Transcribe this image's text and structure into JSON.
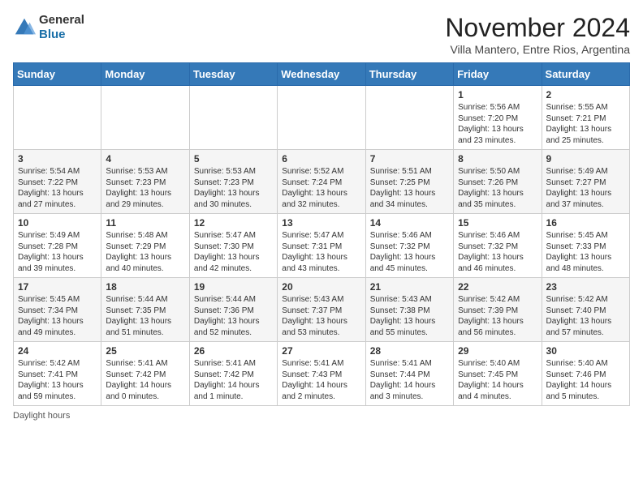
{
  "header": {
    "logo_line1": "General",
    "logo_line2": "Blue",
    "title": "November 2024",
    "subtitle": "Villa Mantero, Entre Rios, Argentina"
  },
  "days_of_week": [
    "Sunday",
    "Monday",
    "Tuesday",
    "Wednesday",
    "Thursday",
    "Friday",
    "Saturday"
  ],
  "footer": {
    "note": "Daylight hours"
  },
  "weeks": [
    [
      {
        "date": "",
        "info": ""
      },
      {
        "date": "",
        "info": ""
      },
      {
        "date": "",
        "info": ""
      },
      {
        "date": "",
        "info": ""
      },
      {
        "date": "",
        "info": ""
      },
      {
        "date": "1",
        "info": "Sunrise: 5:56 AM\nSunset: 7:20 PM\nDaylight: 13 hours and 23 minutes."
      },
      {
        "date": "2",
        "info": "Sunrise: 5:55 AM\nSunset: 7:21 PM\nDaylight: 13 hours and 25 minutes."
      }
    ],
    [
      {
        "date": "3",
        "info": "Sunrise: 5:54 AM\nSunset: 7:22 PM\nDaylight: 13 hours and 27 minutes."
      },
      {
        "date": "4",
        "info": "Sunrise: 5:53 AM\nSunset: 7:23 PM\nDaylight: 13 hours and 29 minutes."
      },
      {
        "date": "5",
        "info": "Sunrise: 5:53 AM\nSunset: 7:23 PM\nDaylight: 13 hours and 30 minutes."
      },
      {
        "date": "6",
        "info": "Sunrise: 5:52 AM\nSunset: 7:24 PM\nDaylight: 13 hours and 32 minutes."
      },
      {
        "date": "7",
        "info": "Sunrise: 5:51 AM\nSunset: 7:25 PM\nDaylight: 13 hours and 34 minutes."
      },
      {
        "date": "8",
        "info": "Sunrise: 5:50 AM\nSunset: 7:26 PM\nDaylight: 13 hours and 35 minutes."
      },
      {
        "date": "9",
        "info": "Sunrise: 5:49 AM\nSunset: 7:27 PM\nDaylight: 13 hours and 37 minutes."
      }
    ],
    [
      {
        "date": "10",
        "info": "Sunrise: 5:49 AM\nSunset: 7:28 PM\nDaylight: 13 hours and 39 minutes."
      },
      {
        "date": "11",
        "info": "Sunrise: 5:48 AM\nSunset: 7:29 PM\nDaylight: 13 hours and 40 minutes."
      },
      {
        "date": "12",
        "info": "Sunrise: 5:47 AM\nSunset: 7:30 PM\nDaylight: 13 hours and 42 minutes."
      },
      {
        "date": "13",
        "info": "Sunrise: 5:47 AM\nSunset: 7:31 PM\nDaylight: 13 hours and 43 minutes."
      },
      {
        "date": "14",
        "info": "Sunrise: 5:46 AM\nSunset: 7:32 PM\nDaylight: 13 hours and 45 minutes."
      },
      {
        "date": "15",
        "info": "Sunrise: 5:46 AM\nSunset: 7:32 PM\nDaylight: 13 hours and 46 minutes."
      },
      {
        "date": "16",
        "info": "Sunrise: 5:45 AM\nSunset: 7:33 PM\nDaylight: 13 hours and 48 minutes."
      }
    ],
    [
      {
        "date": "17",
        "info": "Sunrise: 5:45 AM\nSunset: 7:34 PM\nDaylight: 13 hours and 49 minutes."
      },
      {
        "date": "18",
        "info": "Sunrise: 5:44 AM\nSunset: 7:35 PM\nDaylight: 13 hours and 51 minutes."
      },
      {
        "date": "19",
        "info": "Sunrise: 5:44 AM\nSunset: 7:36 PM\nDaylight: 13 hours and 52 minutes."
      },
      {
        "date": "20",
        "info": "Sunrise: 5:43 AM\nSunset: 7:37 PM\nDaylight: 13 hours and 53 minutes."
      },
      {
        "date": "21",
        "info": "Sunrise: 5:43 AM\nSunset: 7:38 PM\nDaylight: 13 hours and 55 minutes."
      },
      {
        "date": "22",
        "info": "Sunrise: 5:42 AM\nSunset: 7:39 PM\nDaylight: 13 hours and 56 minutes."
      },
      {
        "date": "23",
        "info": "Sunrise: 5:42 AM\nSunset: 7:40 PM\nDaylight: 13 hours and 57 minutes."
      }
    ],
    [
      {
        "date": "24",
        "info": "Sunrise: 5:42 AM\nSunset: 7:41 PM\nDaylight: 13 hours and 59 minutes."
      },
      {
        "date": "25",
        "info": "Sunrise: 5:41 AM\nSunset: 7:42 PM\nDaylight: 14 hours and 0 minutes."
      },
      {
        "date": "26",
        "info": "Sunrise: 5:41 AM\nSunset: 7:42 PM\nDaylight: 14 hours and 1 minute."
      },
      {
        "date": "27",
        "info": "Sunrise: 5:41 AM\nSunset: 7:43 PM\nDaylight: 14 hours and 2 minutes."
      },
      {
        "date": "28",
        "info": "Sunrise: 5:41 AM\nSunset: 7:44 PM\nDaylight: 14 hours and 3 minutes."
      },
      {
        "date": "29",
        "info": "Sunrise: 5:40 AM\nSunset: 7:45 PM\nDaylight: 14 hours and 4 minutes."
      },
      {
        "date": "30",
        "info": "Sunrise: 5:40 AM\nSunset: 7:46 PM\nDaylight: 14 hours and 5 minutes."
      }
    ]
  ]
}
